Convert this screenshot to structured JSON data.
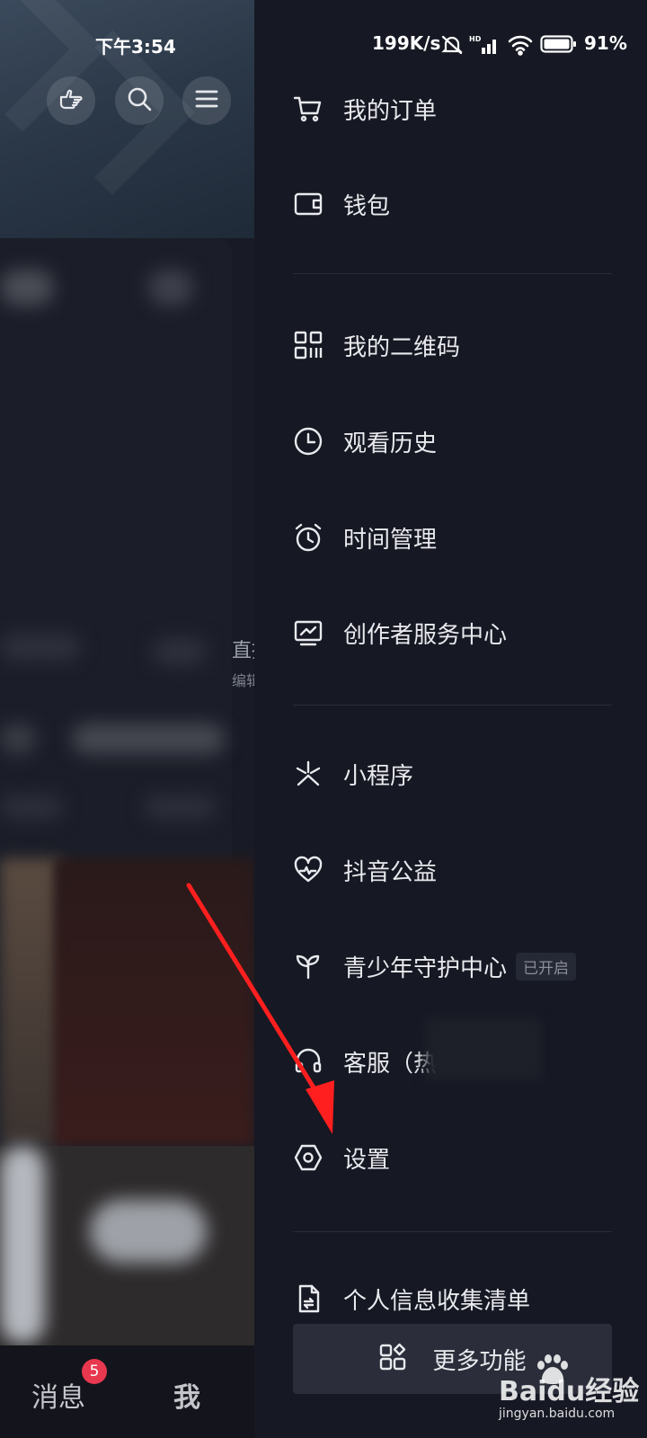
{
  "status_bar": {
    "time": "下午3:54",
    "network_speed": "199K/s",
    "battery": "91%"
  },
  "header_buttons": {
    "icons": [
      "hand-pointer-icon",
      "search-icon",
      "menu-icon"
    ]
  },
  "background_page": {
    "partial_text_1": "直播",
    "partial_text_2": "编辑",
    "nav": {
      "messages_label": "消息",
      "messages_badge": "5",
      "me_label": "我"
    }
  },
  "drawer": {
    "groups": [
      [
        {
          "label": "我的订单",
          "icon": "cart-icon"
        },
        {
          "label": "钱包",
          "icon": "wallet-icon"
        }
      ],
      [
        {
          "label": "我的二维码",
          "icon": "qr-code-icon"
        },
        {
          "label": "观看历史",
          "icon": "clock-icon"
        },
        {
          "label": "时间管理",
          "icon": "alarm-icon"
        },
        {
          "label": "创作者服务中心",
          "icon": "chart-monitor-icon"
        }
      ],
      [
        {
          "label": "小程序",
          "icon": "mini-program-icon"
        },
        {
          "label": "抖音公益",
          "icon": "heart-icon"
        },
        {
          "label": "青少年守护中心",
          "icon": "sprout-icon",
          "badge": "已开启"
        },
        {
          "label": "客服（热",
          "icon": "headset-icon"
        },
        {
          "label": "设置",
          "icon": "settings-icon"
        }
      ],
      [
        {
          "label": "个人信息收集清单",
          "icon": "document-icon"
        }
      ]
    ],
    "more_button": {
      "label": "更多功能",
      "icon": "grid-icon"
    }
  },
  "annotation": {
    "type": "red-arrow",
    "color": "#ff1f1f",
    "target": "设置"
  },
  "watermark": {
    "text": "Baidu经验",
    "sub": "jingyan.baidu.com"
  },
  "colors": {
    "drawer_bg": "#161823",
    "text": "#e9eaee",
    "divider": "#2a2d3a",
    "badge_red": "#e8384f",
    "arrow_red": "#ff1f1f"
  }
}
